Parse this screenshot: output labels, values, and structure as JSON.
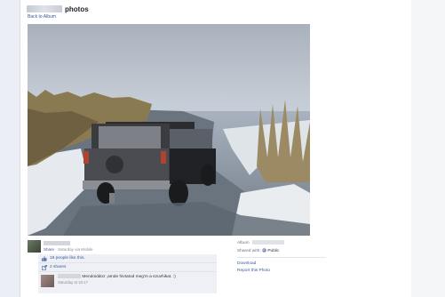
{
  "header": {
    "title": "photos",
    "back_link": "Back to Album"
  },
  "owner": {
    "share_text": "Share",
    "share_meta": "· Saturday via Mobile"
  },
  "ufi": {
    "likes": "19 people like this.",
    "shares": "2 shares",
    "comment": {
      "text": "Mendoiddoz ,amde hivtatod meg'm a szuvhikat. :)",
      "time": "Saturday at 18:17"
    }
  },
  "sidebar": {
    "album_label": "Album",
    "shared_with_label": "Shared with:",
    "shared_with_value": "Public",
    "download": "Download",
    "report": "Report this Photo"
  },
  "colors": {
    "link": "#3b5998",
    "page_bg": "#ebeef4"
  }
}
